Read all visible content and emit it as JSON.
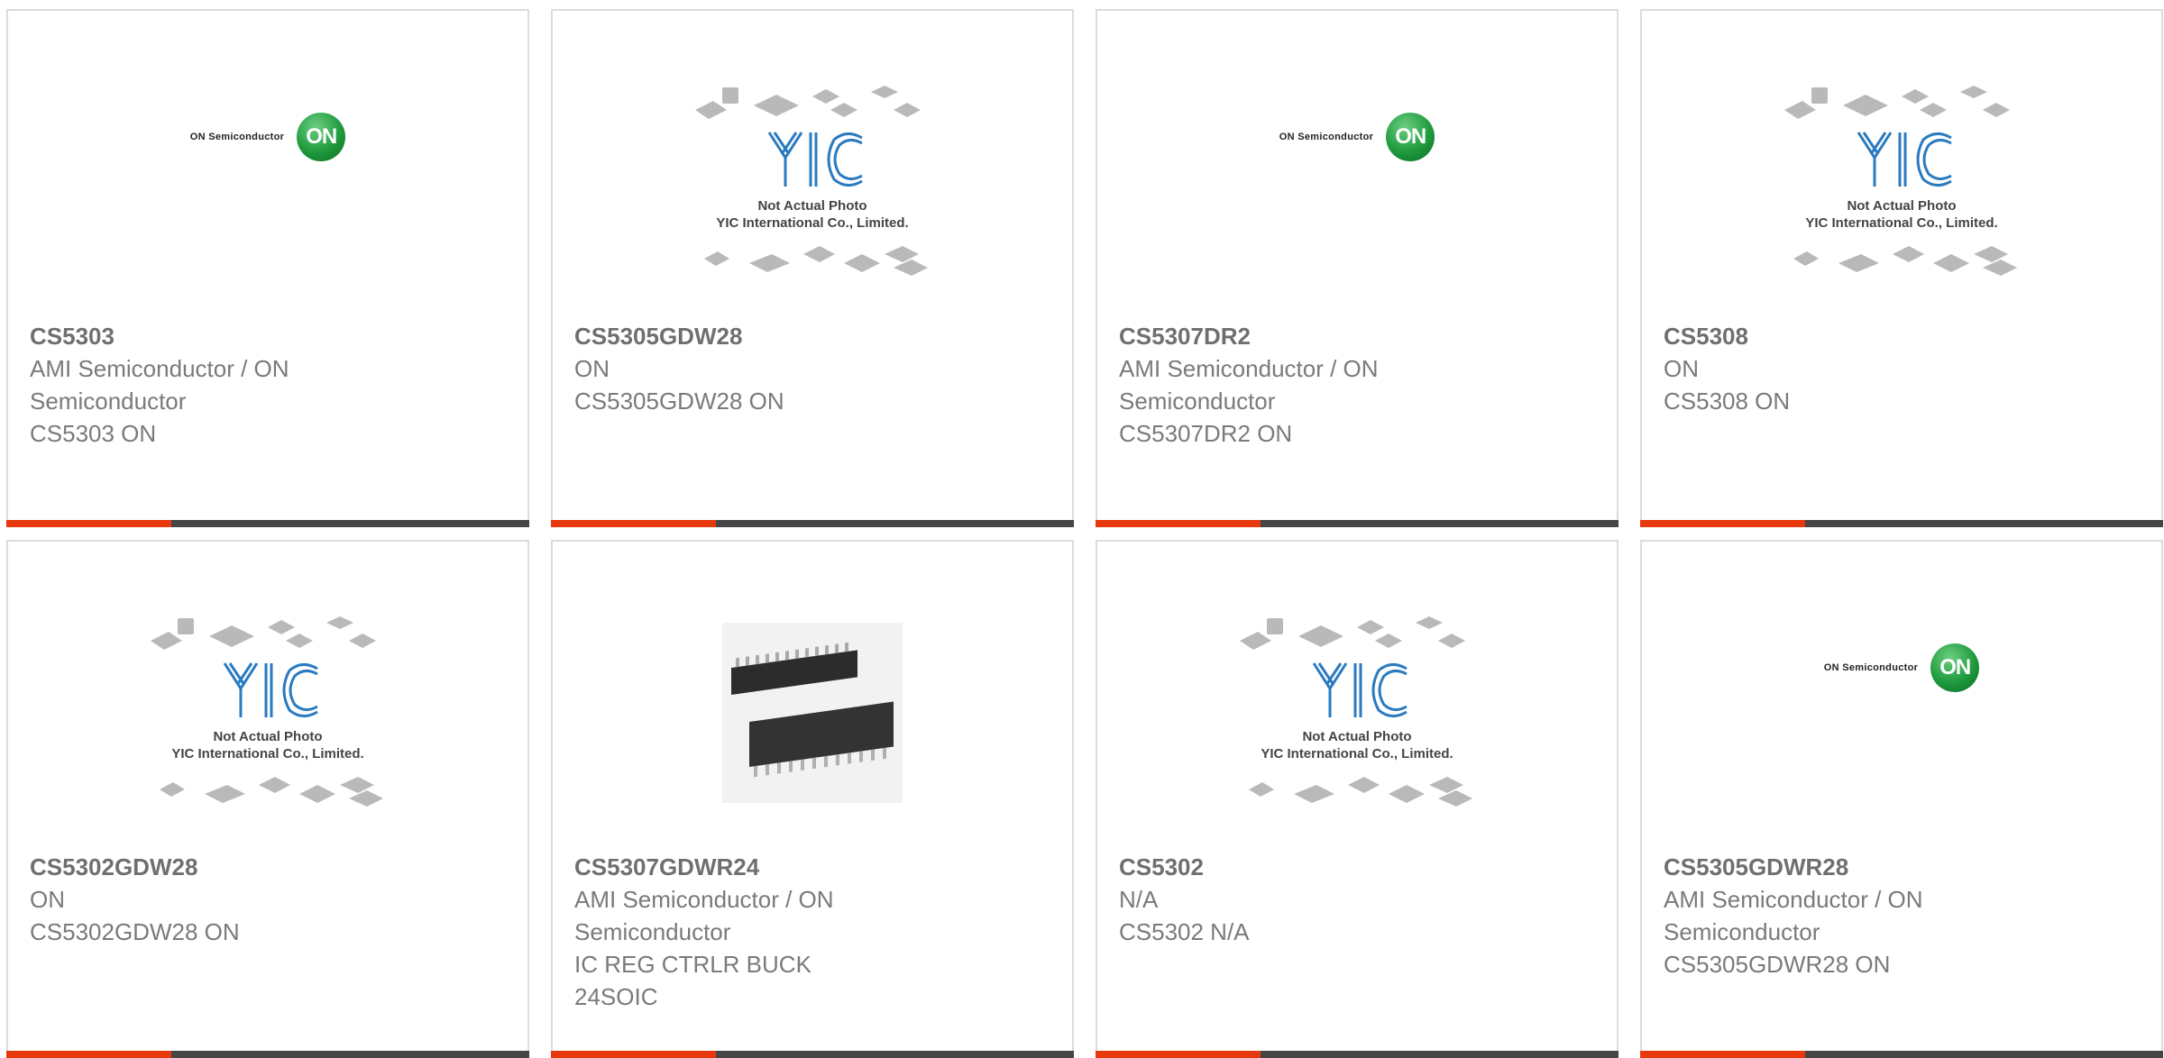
{
  "colors": {
    "accent": "#e8380d",
    "bar": "#454545",
    "text": "#7a7a7a",
    "on_green": "#1f9a3d",
    "yic_blue": "#2a7bbf"
  },
  "logos": {
    "on_text": "ON Semiconductor",
    "on_mark": "ON",
    "yic_line1": "Not Actual Photo",
    "yic_line2": "YIC International Co., Limited."
  },
  "products": [
    {
      "part": "CS5303",
      "maker": "AMI Semiconductor / ON Semiconductor",
      "desc": "CS5303 ON",
      "image": "on-semiconductor-logo"
    },
    {
      "part": "CS5305GDW28",
      "maker": "ON",
      "desc": "CS5305GDW28 ON",
      "image": "yic-placeholder"
    },
    {
      "part": "CS5307DR2",
      "maker": "AMI Semiconductor / ON Semiconductor",
      "desc": "CS5307DR2 ON",
      "image": "on-semiconductor-logo"
    },
    {
      "part": "CS5308",
      "maker": "ON",
      "desc": "CS5308 ON",
      "image": "yic-placeholder"
    },
    {
      "part": "CS5302GDW28",
      "maker": "ON",
      "desc": "CS5302GDW28 ON",
      "image": "yic-placeholder"
    },
    {
      "part": "CS5307GDWR24",
      "maker": "AMI Semiconductor / ON Semiconductor",
      "desc": "IC REG CTRLR BUCK 24SOIC",
      "image": "soic-chip-photo"
    },
    {
      "part": "CS5302",
      "maker": "N/A",
      "desc": "CS5302 N/A",
      "image": "yic-placeholder"
    },
    {
      "part": "CS5305GDWR28",
      "maker": "AMI Semiconductor / ON Semiconductor",
      "desc": "CS5305GDWR28 ON",
      "image": "on-semiconductor-logo"
    }
  ]
}
